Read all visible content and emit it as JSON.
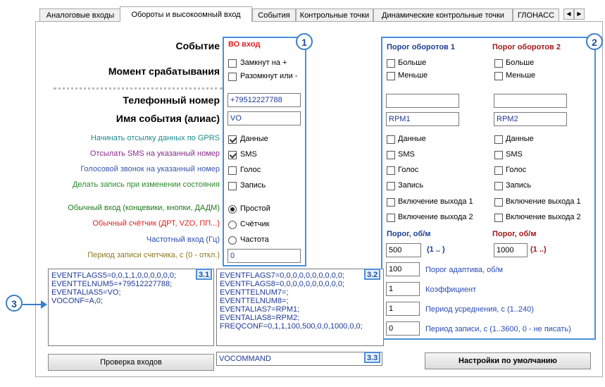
{
  "tabs": [
    {
      "label": "Аналоговые входы",
      "active": false
    },
    {
      "label": "Обороты и высокоомный вход",
      "active": true
    },
    {
      "label": "События",
      "active": false
    },
    {
      "label": "Контрольные точки",
      "active": false
    },
    {
      "label": "Динамические контрольные точки",
      "active": false
    },
    {
      "label": "ГЛОНАСС",
      "active": false
    }
  ],
  "tab_scroll": {
    "left": "◀",
    "right": "▶"
  },
  "left_labels": {
    "event": "Событие",
    "trigger_moment": "Момент срабатывания",
    "phone": "Телефонный номер",
    "alias": "Имя события (алиас)",
    "gprs": "Начинать отсылку данных по GPRS",
    "sms": "Отсылать SMS на указанный номер",
    "voice": "Голосовой звонок на указанный номер",
    "record": "Делать запись при изменении состояния",
    "simple_input": "Обычный вход (концевики, кнопки, ДАДМ)",
    "counter": "Обычный счётчик (ДРТ, VZO, ПП...)",
    "freq": "Частотный вход (Гц)",
    "period": "Период записи счетчика, с (0 - откл.)"
  },
  "vo": {
    "title": "ВО вход",
    "closed": "Замкнут на +",
    "opened": "Разомкнут или -",
    "phone": "+79512227788",
    "alias": "VO",
    "data": "Данные",
    "sms": "SMS",
    "voice": "Голос",
    "record": "Запись",
    "mode_simple": "Простой",
    "mode_counter": "Счётчик",
    "mode_freq": "Частота",
    "period": "0",
    "closed_checked": false,
    "opened_checked": false,
    "data_checked": true,
    "sms_checked": true,
    "voice_checked": false,
    "record_checked": false,
    "mode": "simple"
  },
  "rpm1": {
    "title": "Порог оборотов 1",
    "more": "Больше",
    "less": "Меньше",
    "phone": "",
    "alias": "RPM1",
    "data": "Данные",
    "sms": "SMS",
    "voice": "Голос",
    "record": "Запись",
    "out1": "Включение выхода 1",
    "out2": "Включение выхода 2",
    "threshold_label": "Порог, об/м",
    "threshold": "500",
    "range": "(1 .. )"
  },
  "rpm2": {
    "title": "Порог оборотов 2",
    "more": "Больше",
    "less": "Меньше",
    "phone": "",
    "alias": "RPM2",
    "data": "Данные",
    "sms": "SMS",
    "voice": "Голос",
    "record": "Запись",
    "out1": "Включение выхода 1",
    "out2": "Включение выхода 2",
    "threshold_label": "Порог, об/м",
    "threshold": "1000",
    "range": "(1 ..)"
  },
  "params": [
    {
      "value": "100",
      "label": "Порог адаптива, об/м"
    },
    {
      "value": "1",
      "label": "Коэффициент"
    },
    {
      "value": "1",
      "label": "Период усреднения, с (1..240)"
    },
    {
      "value": "0",
      "label": "Период записи, с (1..3600, 0 - не писать)"
    }
  ],
  "memo1": "EVENTFLAGS5=0,0,1,1,0,0,0,0,0,0;\nEVENTTELNUM5=+79512227788;\nEVENTALIAS5=VO;\nVOCONF=A,0;",
  "memo2": "EVENTFLAGS7=0,0,0,0,0,0,0,0,0,0;\nEVENTFLAGS8=0,0,0,0,0,0,0,0,0,0;\nEVENTTELNUM7=;\nEVENTTELNUM8=;\nEVENTALIAS7=RPM1;\nEVENTALIAS8=RPM2;\nFREQCONF=0,1,1,100,500,0,0,1000,0,0;",
  "command": "VOCOMMAND",
  "buttons": {
    "check": "Проверка входов",
    "defaults": "Настройки по умолчанию"
  },
  "badges": {
    "b1": "1",
    "b2": "2",
    "b3": "3",
    "b31": "3.1",
    "b32": "3.2",
    "b33": "3.3"
  },
  "colors": {
    "accent_blue": "#4a90d9",
    "vo_title": "#e02020",
    "rpm1_title": "#1b3f8f",
    "rpm2_title": "#a01818",
    "gprs": "#1a8a8a",
    "sms": "#8a2a8a",
    "voice": "#3a55b0",
    "record": "#2a8a2a",
    "simple": "#1d7a1d",
    "counter": "#e02020",
    "freq": "#2a4ab0",
    "period": "#8a7a20"
  }
}
